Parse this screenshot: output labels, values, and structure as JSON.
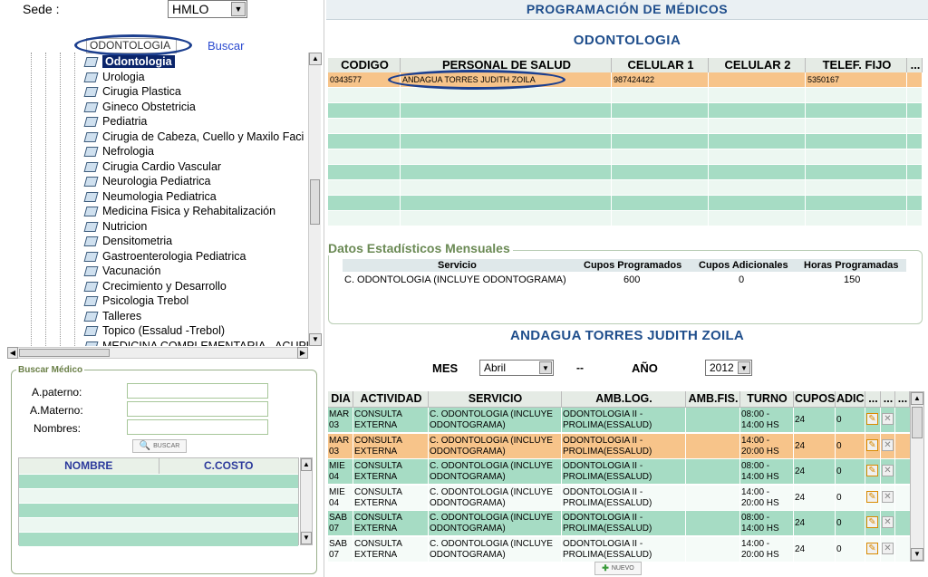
{
  "sede": {
    "label": "Sede :",
    "value": "HMLO"
  },
  "search": {
    "value": "ODONTOLOGIA",
    "button": "Buscar"
  },
  "tree": {
    "items": [
      "Odontologia",
      "Urologia",
      "Cirugia Plastica",
      "Gineco Obstetricia",
      "Pediatria",
      "Cirugia de Cabeza, Cuello y Maxilo Faci",
      "Nefrologia",
      "Cirugia Cardio Vascular",
      "Neurologia Pediatrica",
      "Neumologia Pediatrica",
      "Medicina Fisica y Rehabitalización",
      "Nutricion",
      "Densitometria",
      "Gastroenterologia Pediatrica",
      "Vacunación",
      "Crecimiento y Desarrollo",
      "Psicologia Trebol",
      "Talleres",
      "Topico (Essalud -Trebol)",
      "MEDICINA COMPLEMENTARIA - ACUPUN"
    ],
    "selected": "Odontologia"
  },
  "buscar_medico": {
    "title": "Buscar Médico",
    "apaterno": "A.paterno:",
    "amaterno": "A.Materno:",
    "nombres": "Nombres:",
    "button": "BUSCAR",
    "col_nombre": "NOMBRE",
    "col_ccosto": "C.COSTO"
  },
  "header": {
    "title": "PROGRAMACIÓN  DE  MÉDICOS",
    "specialty": "ODONTOLOGIA"
  },
  "staff_table": {
    "columns": [
      "CODIGO",
      "PERSONAL DE SALUD",
      "CELULAR 1",
      "CELULAR 2",
      "TELEF. FIJO",
      "..."
    ],
    "rows": [
      [
        "0343577",
        "ANDAGUA TORRES JUDITH ZOILA",
        "987424422",
        "",
        "5350167",
        ""
      ]
    ]
  },
  "stats": {
    "title": "Datos Estadísticos Mensuales",
    "columns": [
      "Servicio",
      "Cupos Programados",
      "Cupos Adicionales",
      "Horas Programadas"
    ],
    "row": [
      "C. ODONTOLOGIA (INCLUYE ODONTOGRAMA)",
      "600",
      "0",
      "150"
    ]
  },
  "doctor": {
    "name": "ANDAGUA TORRES JUDITH ZOILA"
  },
  "period": {
    "mes_label": "MES",
    "mes_value": "Abril",
    "dash": "--",
    "anio_label": "AÑO",
    "anio_value": "2012"
  },
  "schedule": {
    "columns": [
      "DIA",
      "ACTIVIDAD",
      "SERVICIO",
      "AMB.LOG.",
      "AMB.FIS.",
      "TURNO",
      "CUPOS",
      "ADIC.",
      "...",
      "...",
      "..."
    ],
    "rows": [
      {
        "dia": "MAR 03",
        "act": "CONSULTA EXTERNA",
        "serv": "C. ODONTOLOGIA (INCLUYE ODONTOGRAMA)",
        "amb": "ODONTOLOGIA II - PROLIMA(ESSALUD)",
        "turno": "08:00 - 14:00 HS",
        "cupos": "24",
        "adic": "0"
      },
      {
        "dia": "MAR 03",
        "act": "CONSULTA EXTERNA",
        "serv": "C. ODONTOLOGIA (INCLUYE ODONTOGRAMA)",
        "amb": "ODONTOLOGIA II - PROLIMA(ESSALUD)",
        "turno": "14:00 - 20:00 HS",
        "cupos": "24",
        "adic": "0"
      },
      {
        "dia": "MIE 04",
        "act": "CONSULTA EXTERNA",
        "serv": "C. ODONTOLOGIA (INCLUYE ODONTOGRAMA)",
        "amb": "ODONTOLOGIA II - PROLIMA(ESSALUD)",
        "turno": "08:00 - 14:00 HS",
        "cupos": "24",
        "adic": "0"
      },
      {
        "dia": "MIE 04",
        "act": "CONSULTA EXTERNA",
        "serv": "C. ODONTOLOGIA (INCLUYE ODONTOGRAMA)",
        "amb": "ODONTOLOGIA II - PROLIMA(ESSALUD)",
        "turno": "14:00 - 20:00 HS",
        "cupos": "24",
        "adic": "0"
      },
      {
        "dia": "SAB 07",
        "act": "CONSULTA EXTERNA",
        "serv": "C. ODONTOLOGIA (INCLUYE ODONTOGRAMA)",
        "amb": "ODONTOLOGIA II - PROLIMA(ESSALUD)",
        "turno": "08:00 - 14:00 HS",
        "cupos": "24",
        "adic": "0"
      },
      {
        "dia": "SAB 07",
        "act": "CONSULTA EXTERNA",
        "serv": "C. ODONTOLOGIA (INCLUYE ODONTOGRAMA)",
        "amb": "ODONTOLOGIA II - PROLIMA(ESSALUD)",
        "turno": "14:00 - 20:00 HS",
        "cupos": "24",
        "adic": "0"
      }
    ]
  },
  "nuevo_button": "NUEVO",
  "colors": {
    "green_row": "#a6dcc4",
    "orange_row": "#f7c48a",
    "title_blue": "#1f4e8c",
    "oval": "#1c3f8f"
  }
}
